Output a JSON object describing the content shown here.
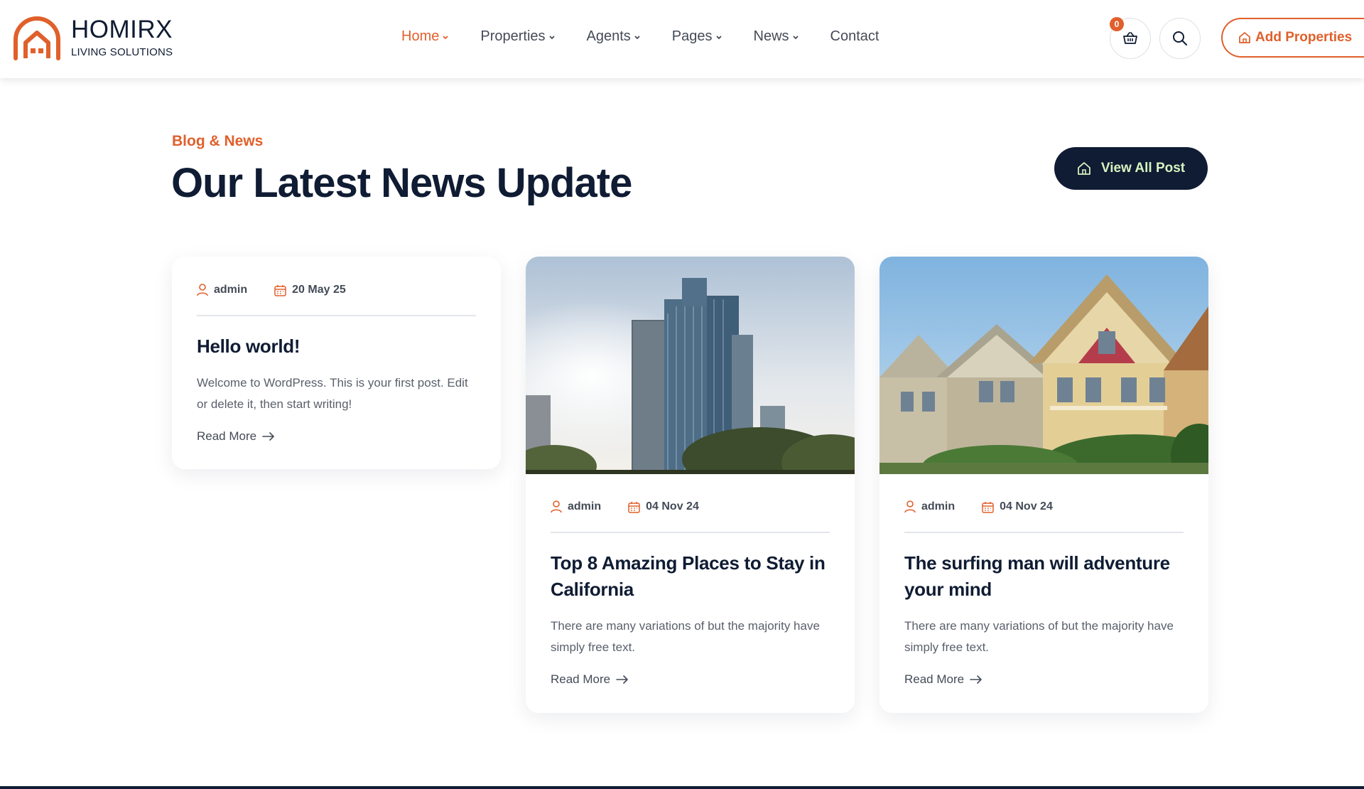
{
  "brand": {
    "name": "HOMIRX",
    "tagline": "LIVING SOLUTIONS",
    "accent_color": "#e0602b",
    "dark_color": "#0f1c33"
  },
  "nav": {
    "items": [
      {
        "label": "Home",
        "has_dropdown": true,
        "active": true
      },
      {
        "label": "Properties",
        "has_dropdown": true
      },
      {
        "label": "Agents",
        "has_dropdown": true
      },
      {
        "label": "Pages",
        "has_dropdown": true
      },
      {
        "label": "News",
        "has_dropdown": true
      },
      {
        "label": "Contact",
        "has_dropdown": false
      }
    ]
  },
  "header_actions": {
    "cart_count": "0",
    "cart_icon": "basket-icon",
    "search_icon": "search-icon",
    "add_properties_label": "Add Properties"
  },
  "section": {
    "tag": "Blog & News",
    "title": "Our Latest News Update",
    "view_all_label": "View All Post"
  },
  "posts": [
    {
      "author": "admin",
      "date": "20 May 25",
      "title": "Hello world!",
      "excerpt": "Welcome to WordPress. This is your first post. Edit or delete it, then start writing!",
      "read_more": "Read More",
      "has_image": false
    },
    {
      "author": "admin",
      "date": "04 Nov 24",
      "title": "Top 8 Amazing Places to Stay in California",
      "excerpt": "There are many variations of but the majority have simply free text.",
      "read_more": "Read More",
      "has_image": true,
      "image_subject": "city-skyscrapers-image"
    },
    {
      "author": "admin",
      "date": "04 Nov 24",
      "title": "The surfing man will adventure your mind",
      "excerpt": "There are many variations of but the majority have simply free text.",
      "read_more": "Read More",
      "has_image": true,
      "image_subject": "victorian-houses-image"
    }
  ]
}
